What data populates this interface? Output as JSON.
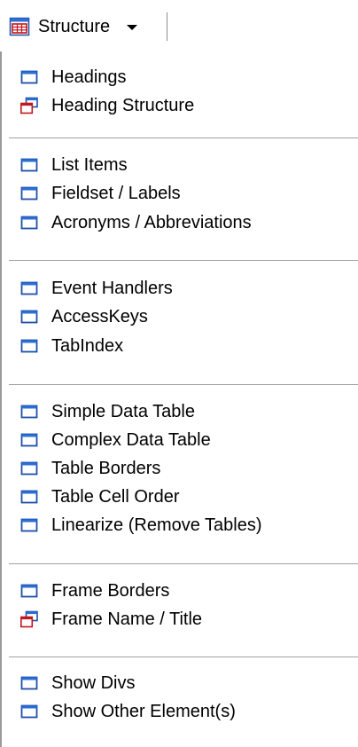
{
  "toolbar": {
    "button_label": "Structure",
    "button_icon": "structure-window-icon",
    "caret_icon": "dropdown-caret-icon"
  },
  "menu": {
    "groups": [
      [
        {
          "label": "Headings",
          "icon": "window-icon"
        },
        {
          "label": "Heading Structure",
          "icon": "new-window-icon"
        }
      ],
      [
        {
          "label": "List Items",
          "icon": "window-icon"
        },
        {
          "label": "Fieldset / Labels",
          "icon": "window-icon"
        },
        {
          "label": "Acronyms / Abbreviations",
          "icon": "window-icon"
        }
      ],
      [
        {
          "label": "Event Handlers",
          "icon": "window-icon"
        },
        {
          "label": "AccessKeys",
          "icon": "window-icon"
        },
        {
          "label": "TabIndex",
          "icon": "window-icon"
        }
      ],
      [
        {
          "label": "Simple Data Table",
          "icon": "window-icon"
        },
        {
          "label": "Complex Data Table",
          "icon": "window-icon"
        },
        {
          "label": "Table Borders",
          "icon": "window-icon"
        },
        {
          "label": "Table Cell Order",
          "icon": "window-icon"
        },
        {
          "label": "Linearize (Remove Tables)",
          "icon": "window-icon"
        }
      ],
      [
        {
          "label": "Frame Borders",
          "icon": "window-icon"
        },
        {
          "label": "Frame Name / Title",
          "icon": "new-window-icon"
        }
      ],
      [
        {
          "label": "Show Divs",
          "icon": "window-icon"
        },
        {
          "label": "Show Other Element(s)",
          "icon": "window-icon"
        }
      ]
    ]
  },
  "colors": {
    "window_blue": "#1f4fa8",
    "window_title_blue": "#2a6fd6",
    "icon_red": "#c4161c",
    "separator": "#a0a0a0"
  }
}
